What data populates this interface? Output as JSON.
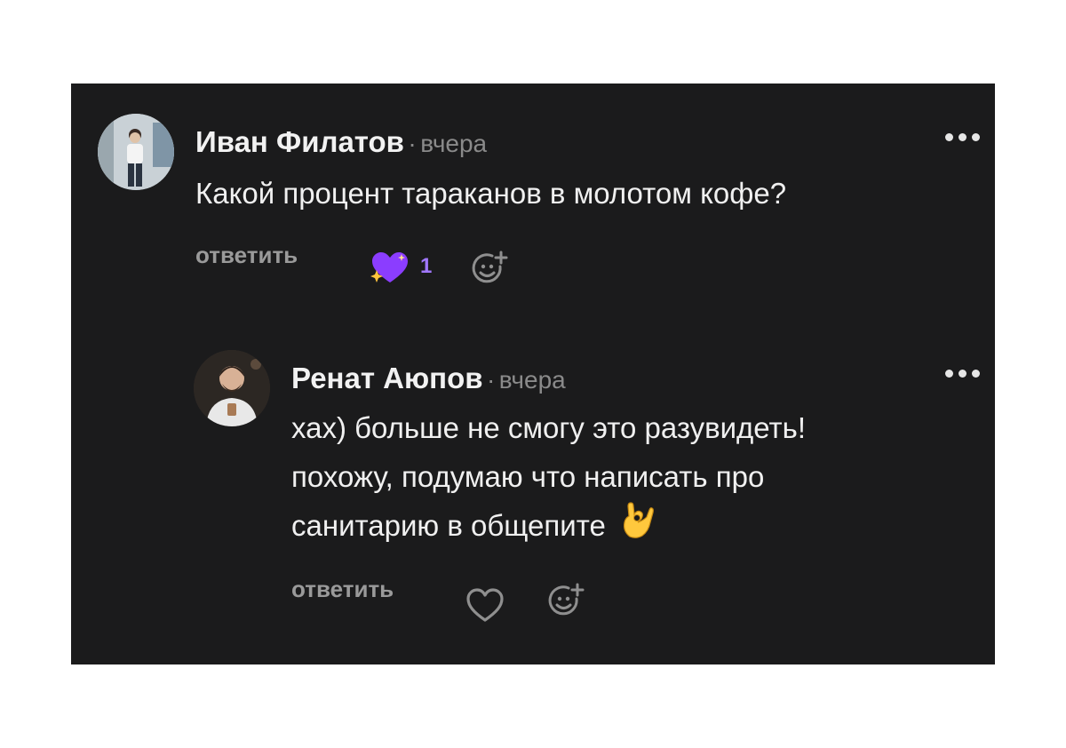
{
  "comments": [
    {
      "author": "Иван Филатов",
      "separator": "·",
      "time": "вчера",
      "text": "Какой процент тараканов в молотом кофе?",
      "reply_label": "ответить",
      "reaction": {
        "icon": "sparkling-heart-icon",
        "count": "1",
        "color": "#8b3dff"
      },
      "add_reaction_icon": "add-emoji-icon"
    },
    {
      "author": "Ренат Аюпов",
      "separator": "·",
      "time": "вчера",
      "text_lines": [
        "хах) больше не смогу это разувидеть!",
        "похожу, подумаю что написать про",
        "санитарию в общепите"
      ],
      "emoji": "👌",
      "reply_label": "ответить",
      "like_icon": "heart-outline-icon",
      "add_reaction_icon": "add-emoji-icon"
    }
  ],
  "colors": {
    "background": "#1b1b1c",
    "text": "#f0f0f0",
    "muted": "#8a8a8a",
    "accent": "#a178ff"
  }
}
